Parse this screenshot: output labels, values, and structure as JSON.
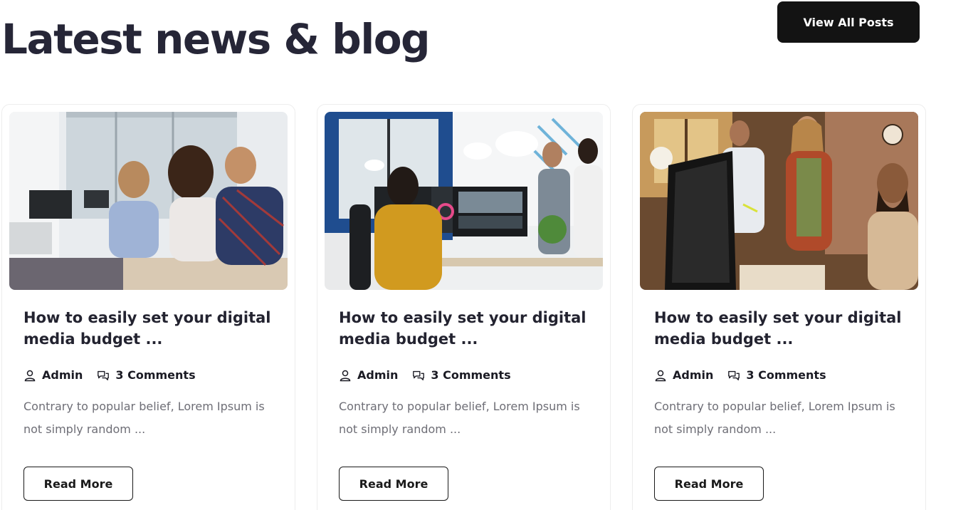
{
  "section": {
    "title": "Latest news & blog",
    "view_all_label": "View All Posts"
  },
  "cards": [
    {
      "image_icon": "office-meeting-photo",
      "title": "How to easily set your digital media budget ...",
      "author": "Admin",
      "comments": "3 Comments",
      "excerpt": "Contrary to popular belief, Lorem Ipsum is not simply random ...",
      "button_label": "Read More"
    },
    {
      "image_icon": "video-editing-desk-photo",
      "title": "How to easily set your digital media budget ...",
      "author": "Admin",
      "comments": "3 Comments",
      "excerpt": "Contrary to popular belief, Lorem Ipsum is not simply random ...",
      "button_label": "Read More"
    },
    {
      "image_icon": "team-discussion-photo",
      "title": "How to easily set your digital media budget ...",
      "author": "Admin",
      "comments": "3 Comments",
      "excerpt": "Contrary to popular belief, Lorem Ipsum is not simply random ...",
      "button_label": "Read More"
    }
  ],
  "colors": {
    "primary_button": "#131313",
    "heading": "#262637",
    "muted_text": "#6e6e76"
  }
}
